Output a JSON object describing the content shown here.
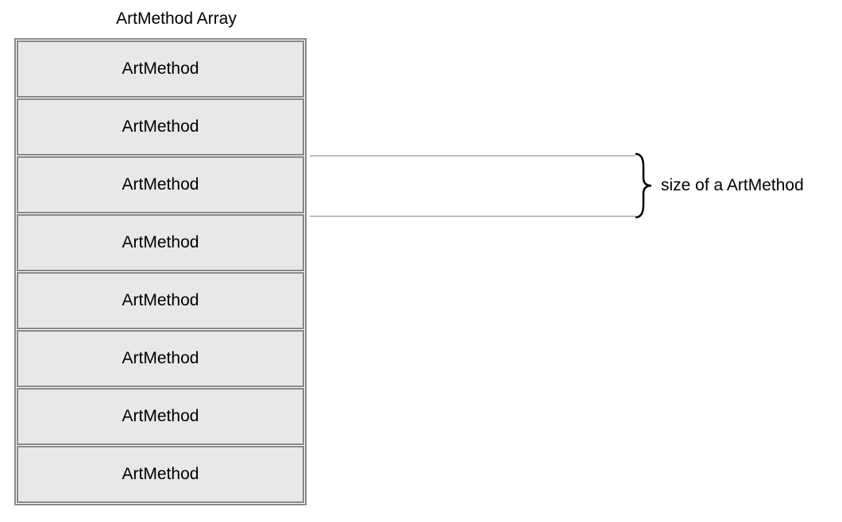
{
  "diagram": {
    "title": "ArtMethod Array",
    "cells": [
      "ArtMethod",
      "ArtMethod",
      "ArtMethod",
      "ArtMethod",
      "ArtMethod",
      "ArtMethod",
      "ArtMethod",
      "ArtMethod"
    ],
    "annotation": "size of a ArtMethod",
    "annotated_index": 2
  }
}
